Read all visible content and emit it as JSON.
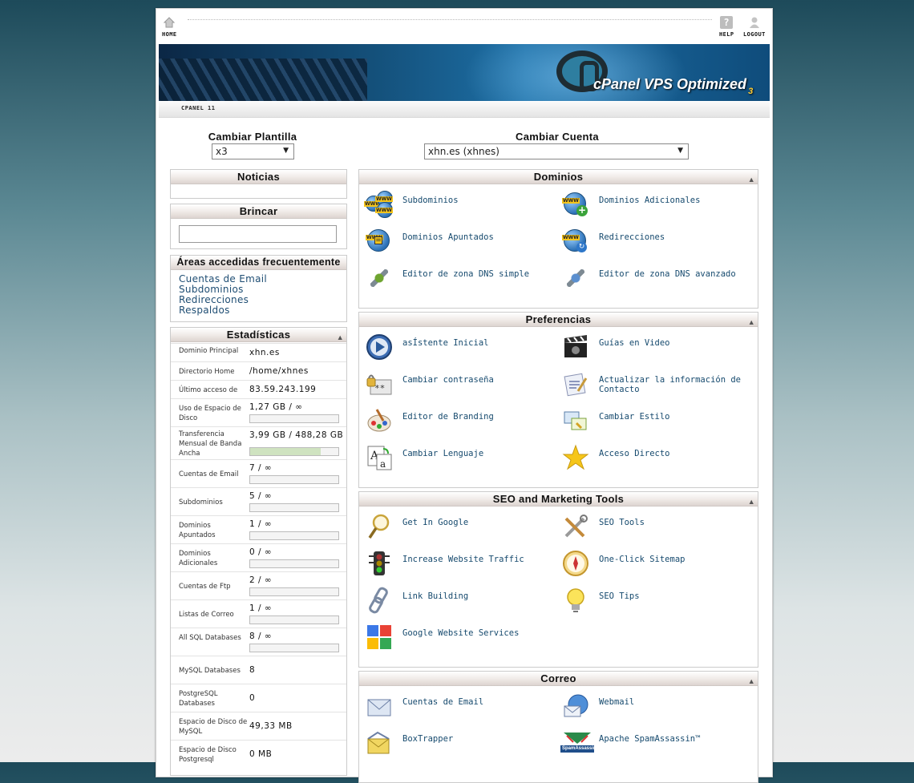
{
  "topbar": {
    "home_label": "HOME",
    "help_label": "HELP",
    "logout_label": "LOGOUT"
  },
  "banner": {
    "brand": "cPanel VPS Optimized",
    "brand_sub": "3"
  },
  "tabbar": {
    "label": "CPANEL 11"
  },
  "selectors": {
    "template_label": "Cambiar Plantilla",
    "template_value": "x3",
    "account_label": "Cambiar Cuenta",
    "account_value": "xhn.es (xhnes)"
  },
  "sidebar": {
    "news_title": "Noticias",
    "jump_title": "Brincar",
    "frequent_title": "Áreas accedidas frecuentemente",
    "frequent_links": [
      "Cuentas de Email",
      "Subdominios",
      "Redirecciones",
      "Respaldos"
    ],
    "stats_title": "Estadísticas",
    "stats": [
      {
        "label": "Dominio Principal",
        "value": "xhn.es"
      },
      {
        "label": "Directorio Home",
        "value": "/home/xhnes"
      },
      {
        "label": "Último acceso de",
        "value": "83.59.243.199"
      },
      {
        "label": "Uso de Espacio de Disco",
        "value": "1,27 GB / ∞",
        "usage": 0
      },
      {
        "label": "Transferencia Mensual de Banda Ancha",
        "value": "3,99 GB / 488,28 GB",
        "usage": 0.8
      },
      {
        "label": "Cuentas de Email",
        "value": "7 / ∞",
        "usage": 0
      },
      {
        "label": "Subdominios",
        "value": "5 / ∞",
        "usage": 0
      },
      {
        "label": "Dominios Apuntados",
        "value": "1 / ∞",
        "usage": 0
      },
      {
        "label": "Dominios Adicionales",
        "value": "0 / ∞",
        "usage": 0
      },
      {
        "label": "Cuentas de Ftp",
        "value": "2 / ∞",
        "usage": 0
      },
      {
        "label": "Listas de Correo",
        "value": "1 / ∞",
        "usage": 0
      },
      {
        "label": "All SQL Databases",
        "value": "8 / ∞",
        "usage": 0
      },
      {
        "label": "MySQL Databases",
        "value": "8"
      },
      {
        "label": "PostgreSQL Databases",
        "value": "0"
      },
      {
        "label": "Espacio de Disco de MySQL",
        "value": "49,33 MB"
      },
      {
        "label": "Espacio de Disco Postgresql",
        "value": "0 MB"
      }
    ]
  },
  "sections": {
    "dominios": {
      "title": "Dominios",
      "items": [
        "Subdominios",
        "Dominios Adicionales",
        "Dominios Apuntados",
        "Redirecciones",
        "Editor de zona DNS simple",
        "Editor de zona DNS avanzado"
      ]
    },
    "preferencias": {
      "title": "Preferencias",
      "items": [
        "asÍstente Inicial",
        "Guías en Video",
        "Cambiar contraseña",
        "Actualizar la información de Contacto",
        "Editor de Branding",
        "Cambiar Estilo",
        "Cambiar Lenguaje",
        "Acceso Directo"
      ]
    },
    "seo": {
      "title": "SEO and Marketing Tools",
      "items": [
        "Get In Google",
        "SEO Tools",
        "Increase Website Traffic",
        "One-Click Sitemap",
        "Link Building",
        "SEO Tips",
        "Google Website Services"
      ]
    },
    "correo": {
      "title": "Correo",
      "items": [
        "Cuentas de Email",
        "Webmail",
        "BoxTrapper",
        "Apache SpamAssassin™"
      ],
      "spamassassin_logo_text": "SpamAssassin"
    }
  },
  "colors": {
    "link": "#1e4d73",
    "panel_header": "#ddd4d0",
    "banner": "#14507a"
  }
}
